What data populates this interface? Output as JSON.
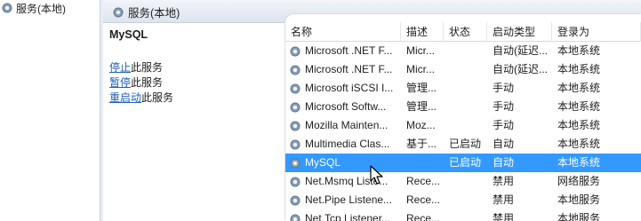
{
  "left_tree": {
    "item_label": "服务(本地)"
  },
  "header": {
    "title": "服务(本地)"
  },
  "description": {
    "service_name": "MySQL",
    "actions": [
      {
        "link": "停止",
        "suffix": "此服务"
      },
      {
        "link": "暂停",
        "suffix": "此服务"
      },
      {
        "link": "重启动",
        "suffix": "此服务"
      }
    ]
  },
  "list": {
    "columns": [
      "名称",
      "描述",
      "状态",
      "启动类型",
      "登录为"
    ],
    "rows": [
      {
        "name": "Microsoft .NET F...",
        "desc": "Micr...",
        "status": "",
        "startup": "自动(延迟...",
        "logon": "本地系统"
      },
      {
        "name": "Microsoft .NET F...",
        "desc": "Micr...",
        "status": "",
        "startup": "自动(延迟...",
        "logon": "本地系统"
      },
      {
        "name": "Microsoft iSCSI I...",
        "desc": "管理...",
        "status": "",
        "startup": "手动",
        "logon": "本地系统"
      },
      {
        "name": "Microsoft Softw...",
        "desc": "管理...",
        "status": "",
        "startup": "手动",
        "logon": "本地系统"
      },
      {
        "name": "Mozilla Mainten...",
        "desc": "Moz...",
        "status": "",
        "startup": "手动",
        "logon": "本地系统"
      },
      {
        "name": "Multimedia Clas...",
        "desc": "基于...",
        "status": "已启动",
        "startup": "自动",
        "logon": "本地系统"
      },
      {
        "name": "MySQL",
        "desc": "",
        "status": "已启动",
        "startup": "自动",
        "logon": "本地系统",
        "selected": true
      },
      {
        "name": "Net.Msmq Liste...",
        "desc": "Rece...",
        "status": "",
        "startup": "禁用",
        "logon": "网络服务"
      },
      {
        "name": "Net.Pipe Listene...",
        "desc": "Rece...",
        "status": "",
        "startup": "禁用",
        "logon": "本地服务"
      },
      {
        "name": "Net.Tcp Listener...",
        "desc": "Rece...",
        "status": "",
        "startup": "禁用",
        "logon": "本地服务"
      }
    ]
  },
  "colors": {
    "selection": "#3399ff",
    "link": "#1f5fb8"
  },
  "icons": {
    "service": "gear-icon",
    "cursor": "mouse-pointer-icon",
    "sort": "sort-ascending-icon"
  }
}
